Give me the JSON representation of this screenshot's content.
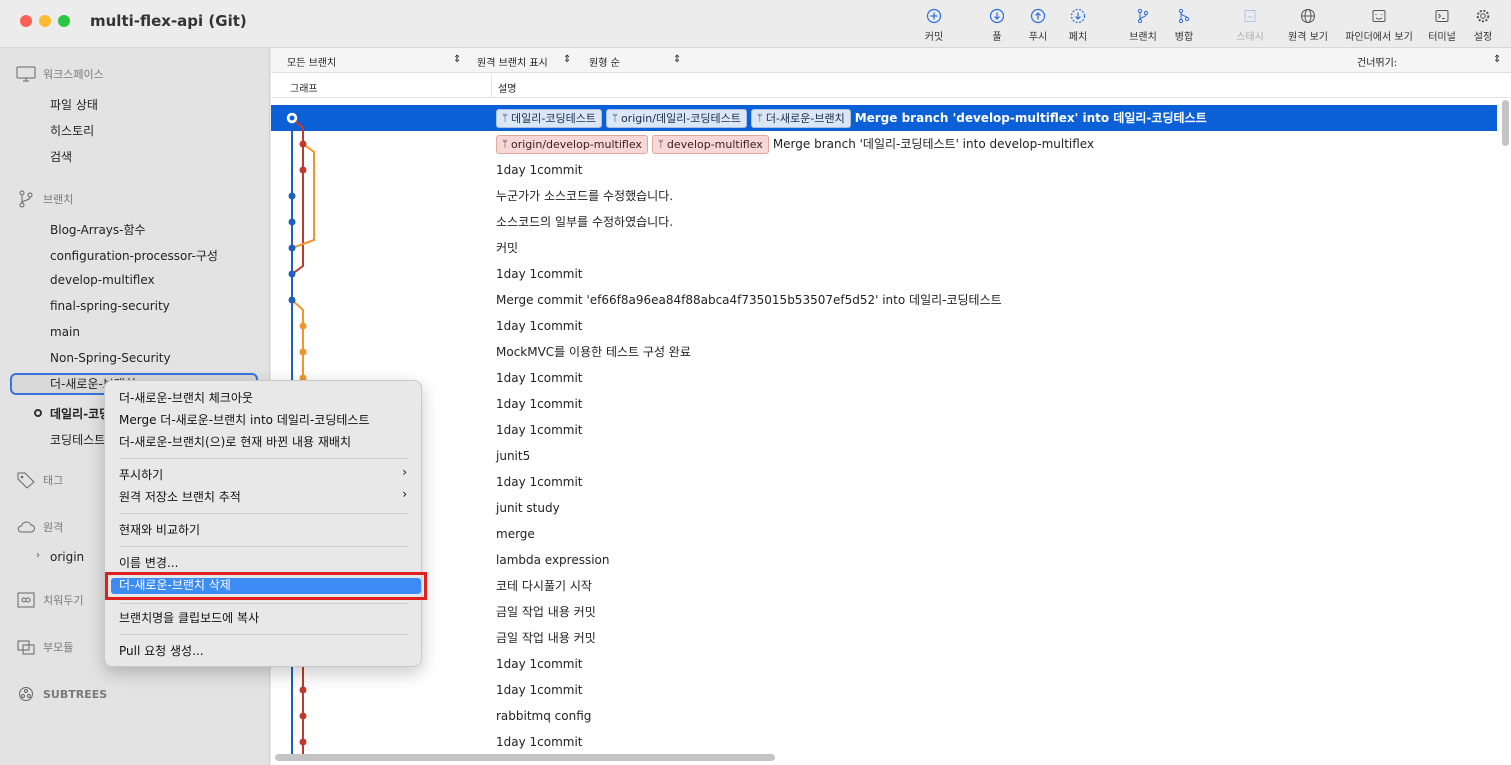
{
  "window": {
    "title": "multi-flex-api (Git)"
  },
  "toolbar": [
    {
      "label": "커밋",
      "icon": "plus-circle-icon"
    },
    {
      "label": "풀",
      "icon": "arrow-down-circle-icon"
    },
    {
      "label": "푸시",
      "icon": "arrow-up-circle-icon"
    },
    {
      "label": "페치",
      "icon": "fetch-icon"
    },
    {
      "label": "브랜치",
      "icon": "branch-icon"
    },
    {
      "label": "병합",
      "icon": "merge-icon"
    },
    {
      "label": "스태시",
      "icon": "stash-icon"
    },
    {
      "label": "원격 보기",
      "icon": "globe-icon"
    },
    {
      "label": "파인더에서 보기",
      "icon": "finder-icon"
    },
    {
      "label": "터미널",
      "icon": "terminal-icon"
    },
    {
      "label": "설정",
      "icon": "gear-icon"
    }
  ],
  "sidebar": {
    "workspace": {
      "title": "워크스페이스",
      "items": [
        "파일 상태",
        "히스토리",
        "검색"
      ]
    },
    "branches": {
      "title": "브랜치",
      "items": [
        "Blog-Arrays-함수",
        "configuration-processor-구성",
        "develop-multiflex",
        "final-spring-security",
        "main",
        "Non-Spring-Security",
        "더-새로운-브랜치",
        "데일리-코딩",
        "코딩테스트"
      ]
    },
    "tags": {
      "title": "태그"
    },
    "remotes": {
      "title": "원격",
      "items": [
        "origin"
      ]
    },
    "stashes": {
      "title": "치워두기"
    },
    "submodules": {
      "title": "부모듈"
    },
    "subtrees": {
      "title": "SUBTREES"
    }
  },
  "filters": {
    "branch": "모든 브랜치",
    "remote": "원격 브랜치 표시",
    "order": "원형 순",
    "skip": "건너뛰기:"
  },
  "columns": {
    "graph": "그래프",
    "description": "설명"
  },
  "commits": [
    {
      "tags": [
        {
          "text": "데일리-코딩테스트",
          "color": "blue"
        },
        {
          "text": "origin/데일리-코딩테스트",
          "color": "blue"
        },
        {
          "text": "더-새로운-브랜치",
          "color": "blue"
        }
      ],
      "message": "Merge branch 'develop-multiflex' into 데일리-코딩테스트"
    },
    {
      "tags": [
        {
          "text": "origin/develop-multiflex",
          "color": "red"
        },
        {
          "text": "develop-multiflex",
          "color": "red"
        }
      ],
      "message": "Merge branch '데일리-코딩테스트' into develop-multiflex"
    },
    {
      "tags": [],
      "message": "1day 1commit"
    },
    {
      "tags": [],
      "message": "누군가가 소스코드를 수정했습니다."
    },
    {
      "tags": [],
      "message": "소스코드의 일부를 수정하였습니다."
    },
    {
      "tags": [],
      "message": "커밋"
    },
    {
      "tags": [],
      "message": "1day 1commit"
    },
    {
      "tags": [],
      "message": "Merge commit 'ef66f8a96ea84f88abca4f735015b53507ef5d52' into 데일리-코딩테스트"
    },
    {
      "tags": [],
      "message": "1day 1commit"
    },
    {
      "tags": [],
      "message": "MockMVC를 이용한 테스트 구성 완료"
    },
    {
      "tags": [],
      "message": "1day 1commit"
    },
    {
      "tags": [],
      "message": "1day 1commit"
    },
    {
      "tags": [],
      "message": "1day 1commit"
    },
    {
      "tags": [],
      "message": "junit5"
    },
    {
      "tags": [],
      "message": "1day 1commit"
    },
    {
      "tags": [],
      "message": "junit study"
    },
    {
      "tags": [],
      "message": "merge"
    },
    {
      "tags": [],
      "message": "lambda expression"
    },
    {
      "tags": [],
      "message": "코테 다시풀기 시작"
    },
    {
      "tags": [],
      "message": "금일 작업 내용 커밋"
    },
    {
      "tags": [],
      "message": "금일 작업 내용 커밋"
    },
    {
      "tags": [],
      "message": "1day 1commit"
    },
    {
      "tags": [],
      "message": "1day 1commit"
    },
    {
      "tags": [],
      "message": "rabbitmq config"
    },
    {
      "tags": [],
      "message": "1day 1commit"
    }
  ],
  "context_menu": {
    "group1": [
      "더-새로운-브랜치 체크아웃",
      "Merge 더-새로운-브랜치 into 데일리-코딩테스트",
      "더-새로운-브랜치(으)로 현재 바뀐 내용 재배치"
    ],
    "group2": [
      "푸시하기",
      "원격 저장소 브랜치 추적"
    ],
    "group3": [
      "현재와 비교하기"
    ],
    "group4": [
      "이름 변경...",
      "더-새로운-브랜치 삭제"
    ],
    "group5": [
      "브랜치명을 클립보드에 복사"
    ],
    "group6": [
      "Pull 요청 생성..."
    ],
    "highlighted": "더-새로운-브랜치 삭제"
  },
  "colors": {
    "selection": "#0b5fd7",
    "lane_blue": "#1f5fbf",
    "lane_red": "#c0392b",
    "lane_orange": "#f0962e",
    "highlight_box": "#e0201c"
  }
}
